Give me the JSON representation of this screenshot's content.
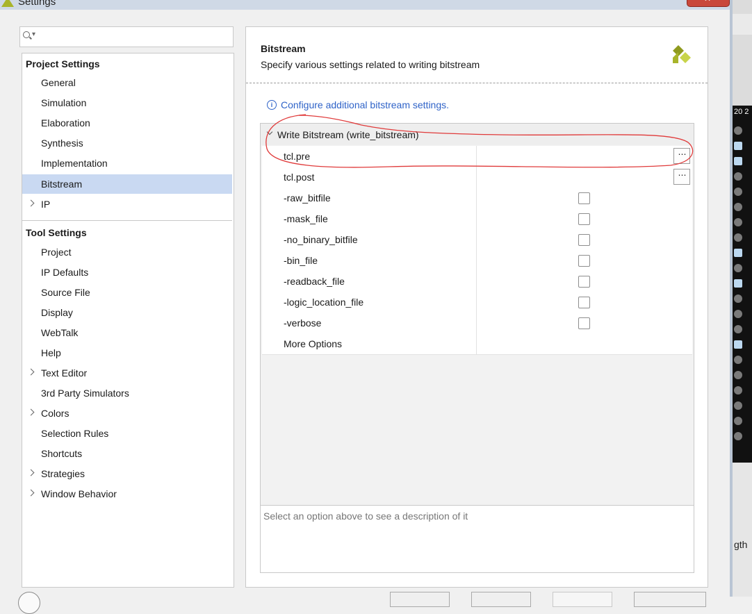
{
  "window": {
    "title": "Settings"
  },
  "search": {
    "placeholder": "",
    "value": ""
  },
  "tree": {
    "project_section": "Project Settings",
    "project_items": [
      "General",
      "Simulation",
      "Elaboration",
      "Synthesis",
      "Implementation",
      "Bitstream",
      "IP"
    ],
    "selected": "Bitstream",
    "tool_section": "Tool Settings",
    "tool_items": [
      "Project",
      "IP Defaults",
      "Source File",
      "Display",
      "WebTalk",
      "Help",
      "Text Editor",
      "3rd Party Simulators",
      "Colors",
      "Selection Rules",
      "Shortcuts",
      "Strategies",
      "Window Behavior"
    ]
  },
  "content": {
    "title": "Bitstream",
    "description": "Specify various settings related to writing bitstream",
    "info_link": "Configure additional bitstream settings.",
    "group_label": "Write Bitstream (write_bitstream)",
    "rows": [
      {
        "name": "tcl.pre",
        "kind": "browse"
      },
      {
        "name": "tcl.post",
        "kind": "browse"
      },
      {
        "name": "-raw_bitfile",
        "kind": "checkbox",
        "checked": false
      },
      {
        "name": "-mask_file",
        "kind": "checkbox",
        "checked": false
      },
      {
        "name": "-no_binary_bitfile",
        "kind": "checkbox",
        "checked": false
      },
      {
        "name": "-bin_file",
        "kind": "checkbox",
        "checked": false
      },
      {
        "name": "-readback_file",
        "kind": "checkbox",
        "checked": false
      },
      {
        "name": "-logic_location_file",
        "kind": "checkbox",
        "checked": false
      },
      {
        "name": "-verbose",
        "kind": "checkbox",
        "checked": false
      },
      {
        "name": "More Options",
        "kind": "text"
      }
    ],
    "browse_label": "⋯",
    "description_box": "Select an option above to see a description of it"
  },
  "background": {
    "column_header": "20 2",
    "partial_label": "gth"
  },
  "colors": {
    "selection": "#c9d9f2",
    "link": "#2f63c8",
    "annotation": "#e03a3a",
    "logo": "#a8b42a"
  }
}
